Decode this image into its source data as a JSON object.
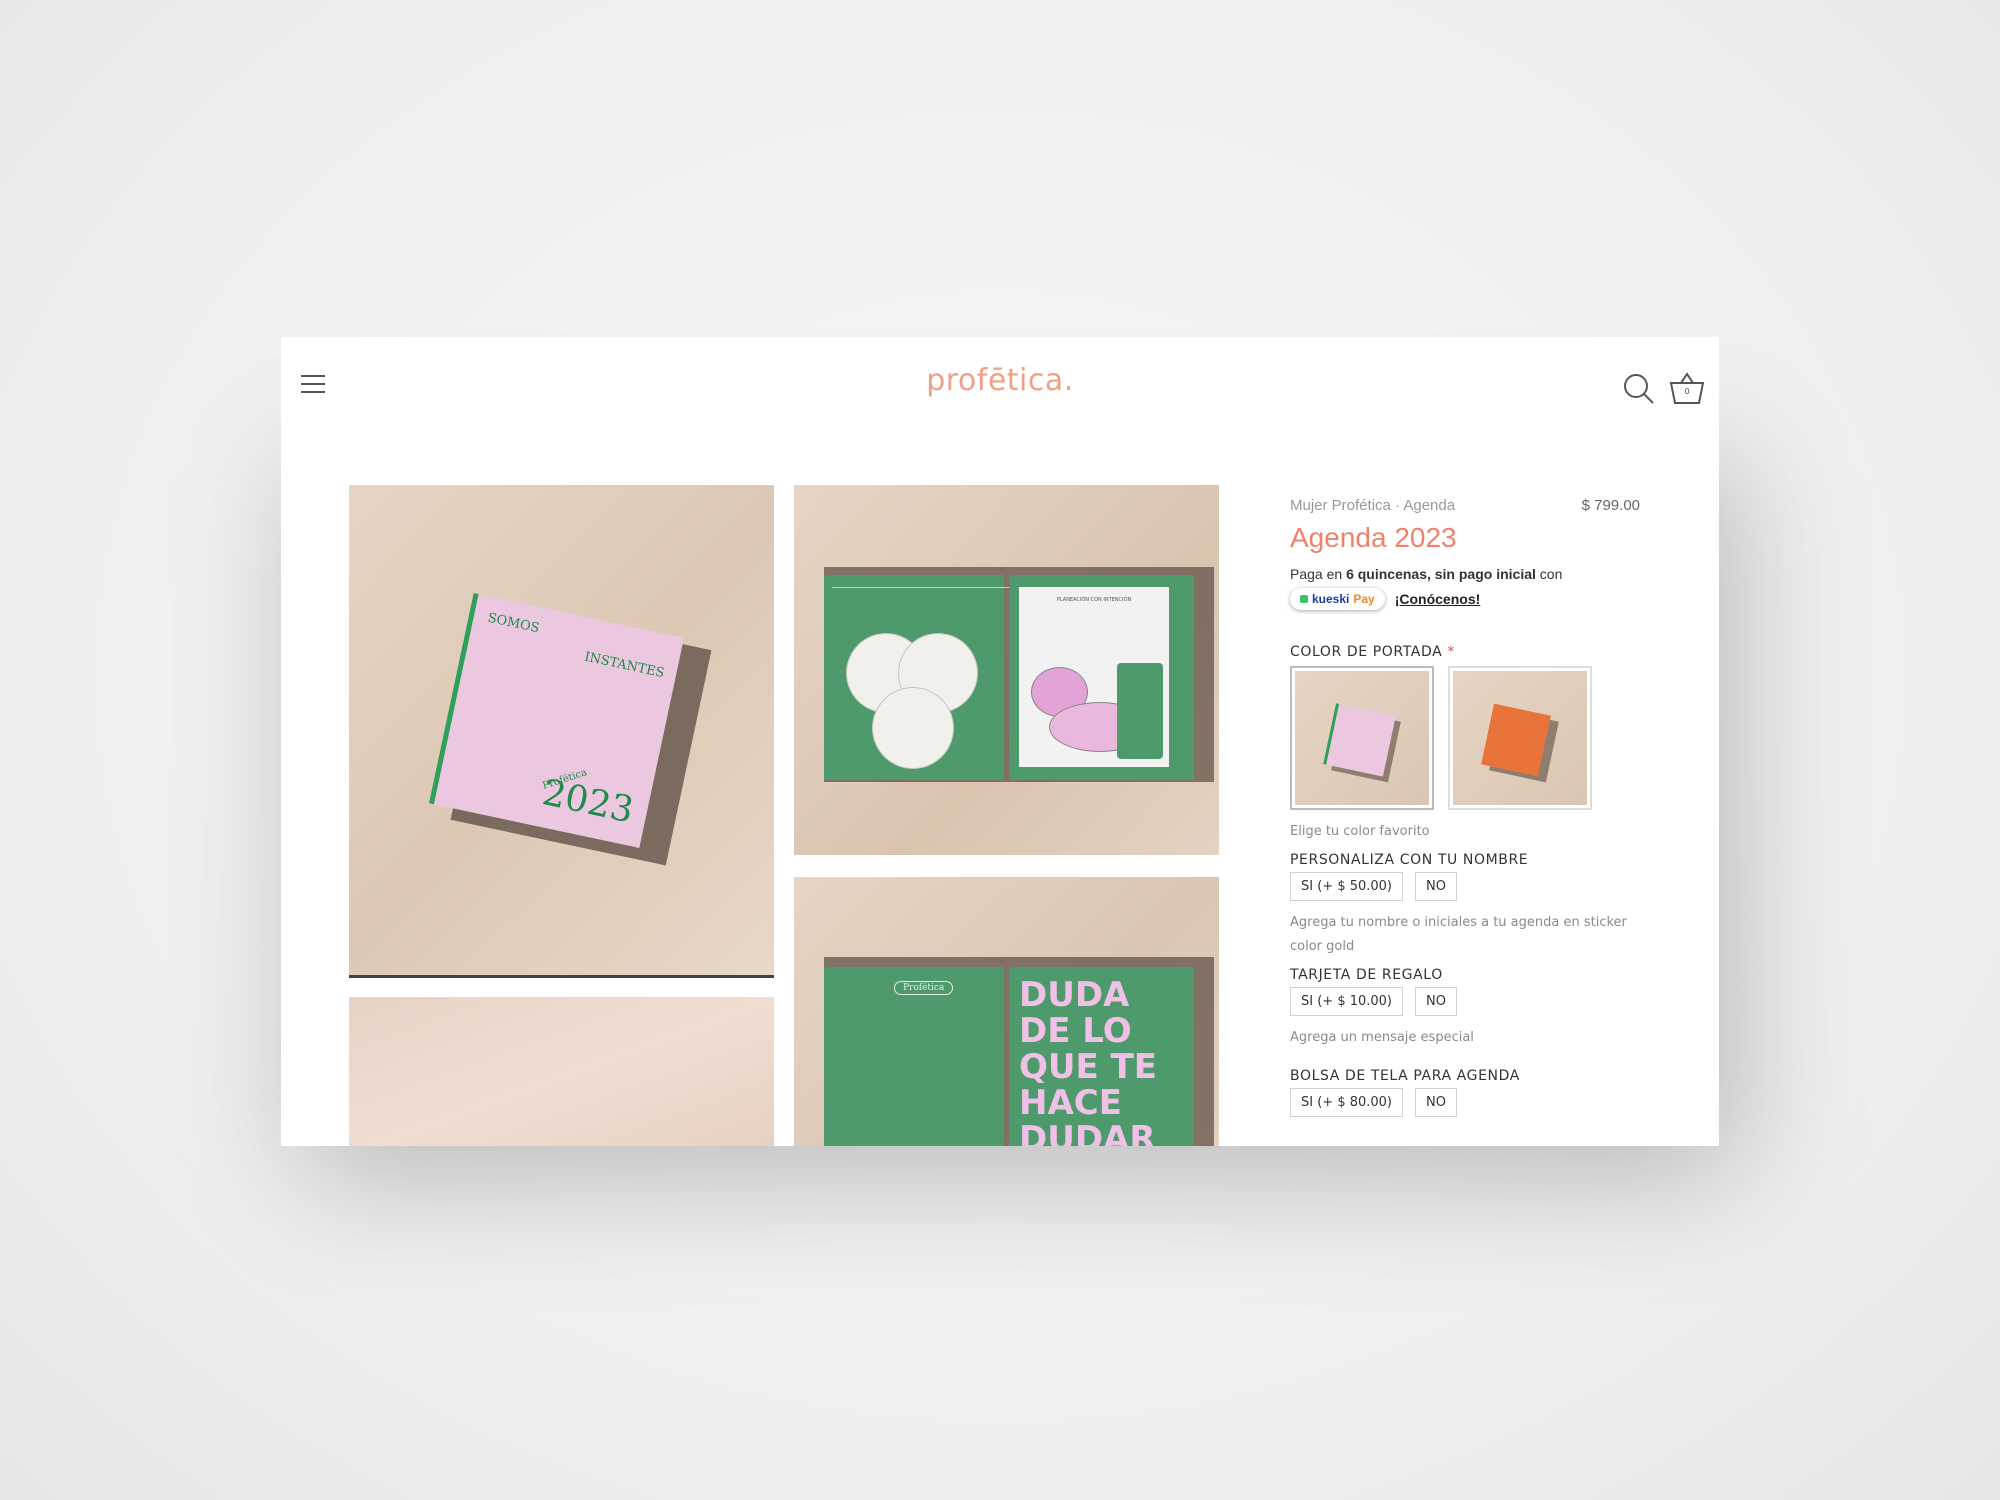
{
  "header": {
    "logo": "profētica.",
    "cart_count": "0"
  },
  "gallery": {
    "book_cover": {
      "line1": "SOMOS",
      "line2": "INSTANTES",
      "year": "2023",
      "brand": "Profética"
    },
    "planner_page": {
      "heading": "PLANEACIÓN CON INTENCIÓN"
    },
    "quote_page": {
      "badge": "Profética",
      "quote": "DUDA DE LO QUE TE HACE DUDAR"
    }
  },
  "product": {
    "breadcrumb": "Mujer Profética · Agenda",
    "price": "$ 799.00",
    "title": "Agenda 2023",
    "payment": {
      "prefix": "Paga en ",
      "bold": "6 quincenas, sin pago inicial",
      "suffix": " con",
      "provider_a": "kueski",
      "provider_b": "Pay",
      "link": "¡Conócenos!"
    },
    "cover_color": {
      "label": "COLOR DE PORTADA",
      "required_mark": "*",
      "hint": "Elige tu color favorito",
      "swatches": [
        {
          "name": "rosa",
          "color": "#ebc7e0"
        },
        {
          "name": "naranja",
          "color": "#e8743a"
        }
      ]
    },
    "personalize": {
      "label": "PERSONALIZA CON TU NOMBRE",
      "yes": "SI (+ $ 50.00)",
      "no": "NO",
      "hint": "Agrega tu nombre o iniciales a tu agenda en sticker color gold"
    },
    "gift_card": {
      "label": "TARJETA DE REGALO",
      "yes": "SI (+ $ 10.00)",
      "no": "NO",
      "hint": "Agrega un mensaje especial"
    },
    "bag": {
      "label": "BOLSA DE TELA PARA AGENDA",
      "yes": "SI (+ $ 80.00)",
      "no": "NO"
    }
  },
  "colors": {
    "brand": "#f0a084",
    "title": "#f0826c",
    "green": "#4e9a6c",
    "pink": "#ebc7e0"
  }
}
